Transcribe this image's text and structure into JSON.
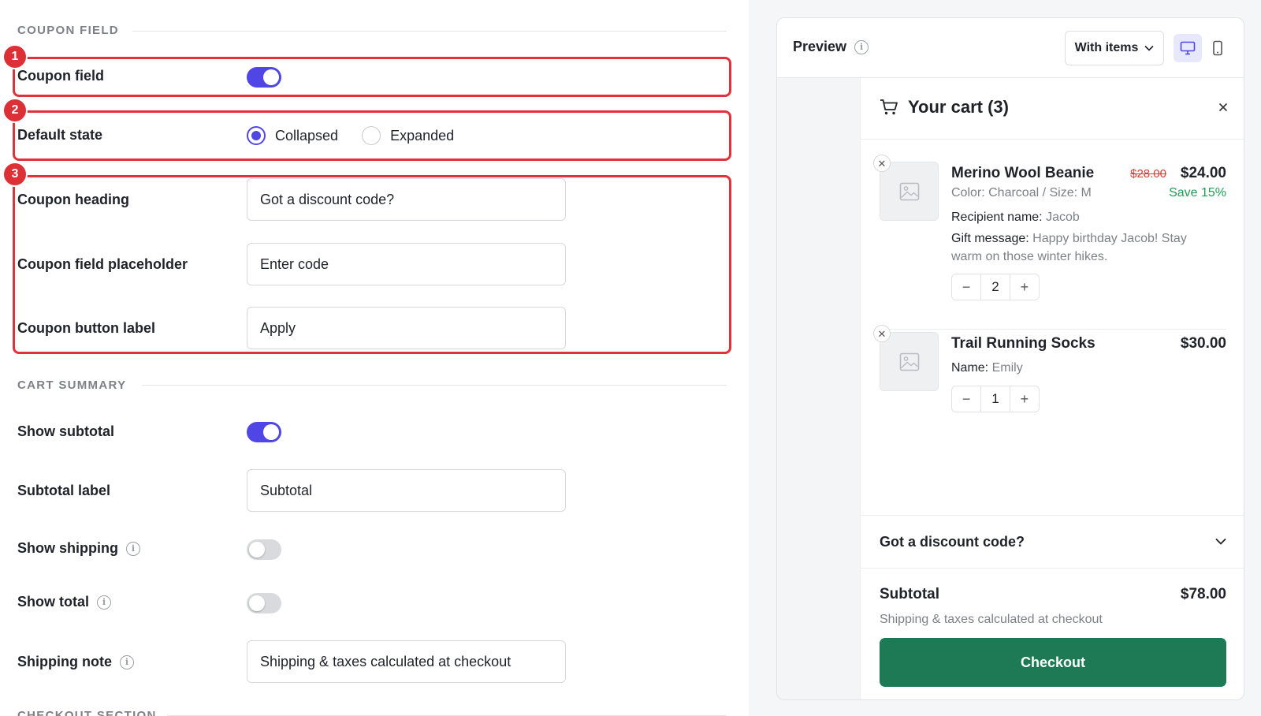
{
  "sections": {
    "coupon_field": "COUPON FIELD",
    "cart_summary": "CART SUMMARY",
    "checkout_section": "CHECKOUT SECTION"
  },
  "badges": [
    "1",
    "2",
    "3"
  ],
  "coupon": {
    "field_label": "Coupon field",
    "field_enabled": true,
    "default_state_label": "Default state",
    "default_state_options": [
      "Collapsed",
      "Expanded"
    ],
    "default_state_selected": "Collapsed",
    "heading_label": "Coupon heading",
    "heading_value": "Got a discount code?",
    "placeholder_label": "Coupon field placeholder",
    "placeholder_value": "Enter code",
    "button_label_label": "Coupon button label",
    "button_label_value": "Apply"
  },
  "summary": {
    "show_subtotal_label": "Show subtotal",
    "show_subtotal": true,
    "subtotal_label_label": "Subtotal label",
    "subtotal_label_value": "Subtotal",
    "show_shipping_label": "Show shipping",
    "show_shipping": false,
    "show_total_label": "Show total",
    "show_total": false,
    "shipping_note_label": "Shipping note",
    "shipping_note_value": "Shipping & taxes calculated at checkout"
  },
  "preview": {
    "title": "Preview",
    "mode": "With items",
    "device_selected": "desktop",
    "cart": {
      "title": "Your cart (3)",
      "items": [
        {
          "name": "Merino Wool Beanie",
          "compare_price": "$28.00",
          "price": "$24.00",
          "save": "Save 15%",
          "meta": "Color: Charcoal / Size: M",
          "recipient_key": "Recipient name:",
          "recipient_value": "Jacob",
          "gift_key": "Gift message:",
          "gift_value": "Happy birthday Jacob! Stay warm on those winter hikes.",
          "qty": "2"
        },
        {
          "name": "Trail Running Socks",
          "price": "$30.00",
          "name_key": "Name:",
          "name_value": "Emily",
          "qty": "1"
        }
      ],
      "coupon_heading": "Got a discount code?",
      "subtotal_label": "Subtotal",
      "subtotal_value": "$78.00",
      "shipping_note": "Shipping & taxes calculated at checkout",
      "checkout_label": "Checkout"
    }
  },
  "colors": {
    "accent": "#4f46e5",
    "highlight": "#e0323a",
    "checkout": "#1d7a55",
    "save": "#1f9d55",
    "compare_price": "#d0413a"
  }
}
